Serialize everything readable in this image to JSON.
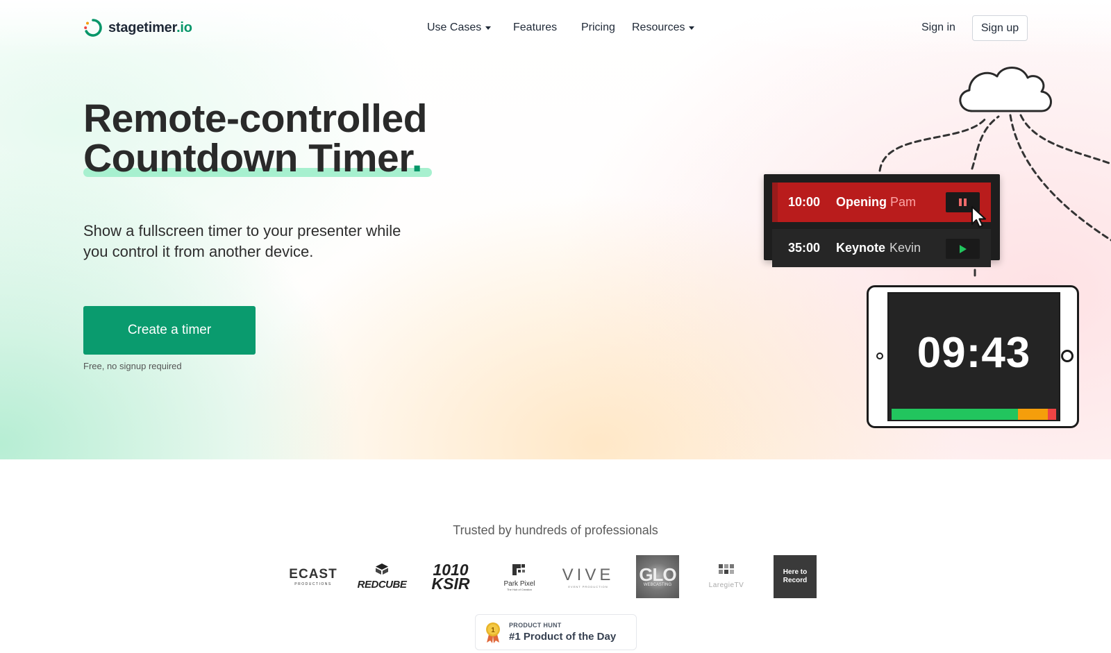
{
  "nav": {
    "logo_name": "stagetimer",
    "logo_tld": ".io",
    "links": [
      {
        "label": "Use Cases",
        "dropdown": true
      },
      {
        "label": "Features",
        "dropdown": false
      },
      {
        "label": "Pricing",
        "dropdown": false
      },
      {
        "label": "Resources",
        "dropdown": true
      }
    ],
    "sign_in": "Sign in",
    "sign_up": "Sign up"
  },
  "hero": {
    "headline_line1": "Remote-controlled",
    "headline_line2": "Countdown Timer",
    "headline_dot": ".",
    "subheadline": "Show a fullscreen timer to your presenter while you control it from another device.",
    "cta_label": "Create a timer",
    "cta_note": "Free, no signup required"
  },
  "illustration": {
    "timers": [
      {
        "time": "10:00",
        "title": "Opening",
        "speaker": "Pam",
        "state": "running",
        "control_icon": "pause-icon"
      },
      {
        "time": "35:00",
        "title": "Keynote",
        "speaker": "Kevin",
        "state": "idle",
        "control_icon": "play-icon"
      }
    ],
    "display_clock_minutes": "09",
    "display_clock_separator": ":",
    "display_clock_seconds": "43",
    "progress_segments": [
      {
        "color": "#22c55e",
        "fraction": 0.79
      },
      {
        "color": "#f59e0b",
        "fraction": 0.19
      },
      {
        "color": "#ef4444",
        "fraction": 0.05
      }
    ]
  },
  "trusted": {
    "heading": "Trusted by hundreds of professionals",
    "logos": [
      {
        "name": "ecast-logo",
        "text": "ECAST",
        "subtext": "PRODUCTIONS"
      },
      {
        "name": "red-cube-logo",
        "text": "REDCUBE"
      },
      {
        "name": "1010-ksir-logo",
        "text": "1010",
        "subtext": "KSIR"
      },
      {
        "name": "park-pixel-logo",
        "text": "Park Pixel",
        "subtext": "The Hub of Creation"
      },
      {
        "name": "vive-logo",
        "text": "VIVE",
        "subtext": "EVENT PRODUCTION"
      },
      {
        "name": "glo-webcasting-logo",
        "text": "GLO",
        "subtext": "WEBCASTING"
      },
      {
        "name": "laregie-tv-logo",
        "text": "LaregieTV"
      },
      {
        "name": "here-to-record-logo",
        "text": "Here to Record"
      }
    ]
  },
  "product_hunt": {
    "kicker": "PRODUCT HUNT",
    "title": "#1 Product of the Day",
    "medal_number": "1"
  },
  "colors": {
    "brand": "#079669",
    "cta": "#0a9b6e",
    "highlight": "#a7f0cf",
    "timer_active": "#b91c1c"
  }
}
